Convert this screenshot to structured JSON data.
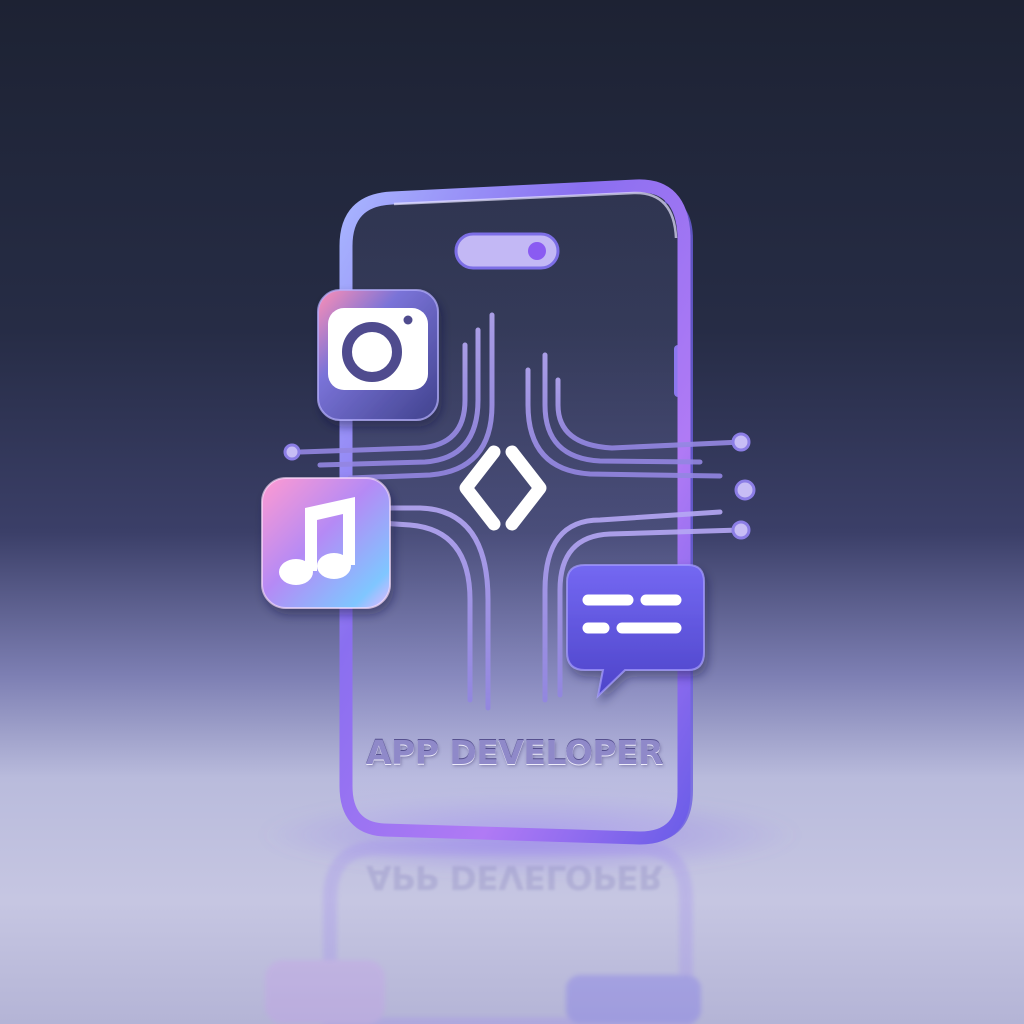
{
  "scene": {
    "headline": "APP DEVELOPER",
    "icons": [
      "camera-icon",
      "music-note-icon",
      "code-brackets-icon",
      "chat-bubble-icon"
    ],
    "colors": {
      "background_top": "#1d2233",
      "background_bottom": "#c6c6e2",
      "phone_frame": "#8a6ff0",
      "accent_purple": "#6a5ff0",
      "text": "#8f89c9"
    }
  }
}
